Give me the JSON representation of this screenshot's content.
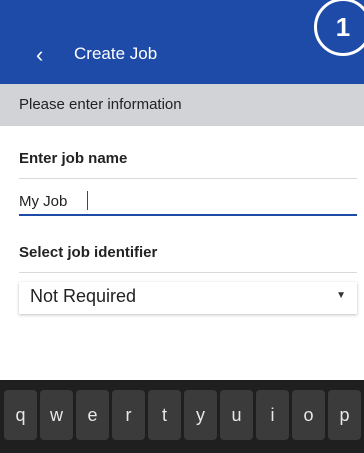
{
  "header": {
    "title": "Create Job",
    "back_icon": "‹",
    "badge": "1"
  },
  "banner": {
    "text": "Please enter information"
  },
  "job_name": {
    "label": "Enter job name",
    "value": "My Job"
  },
  "job_identifier": {
    "label": "Select job identifier",
    "selected": "Not Required"
  },
  "keyboard": {
    "keys": [
      "q",
      "w",
      "e",
      "r",
      "t",
      "y",
      "u",
      "i",
      "o",
      "p"
    ]
  },
  "colors": {
    "primary": "#1e4aa8",
    "banner_bg": "#d2d3d6",
    "keyboard_bg": "#1f1f1f"
  }
}
